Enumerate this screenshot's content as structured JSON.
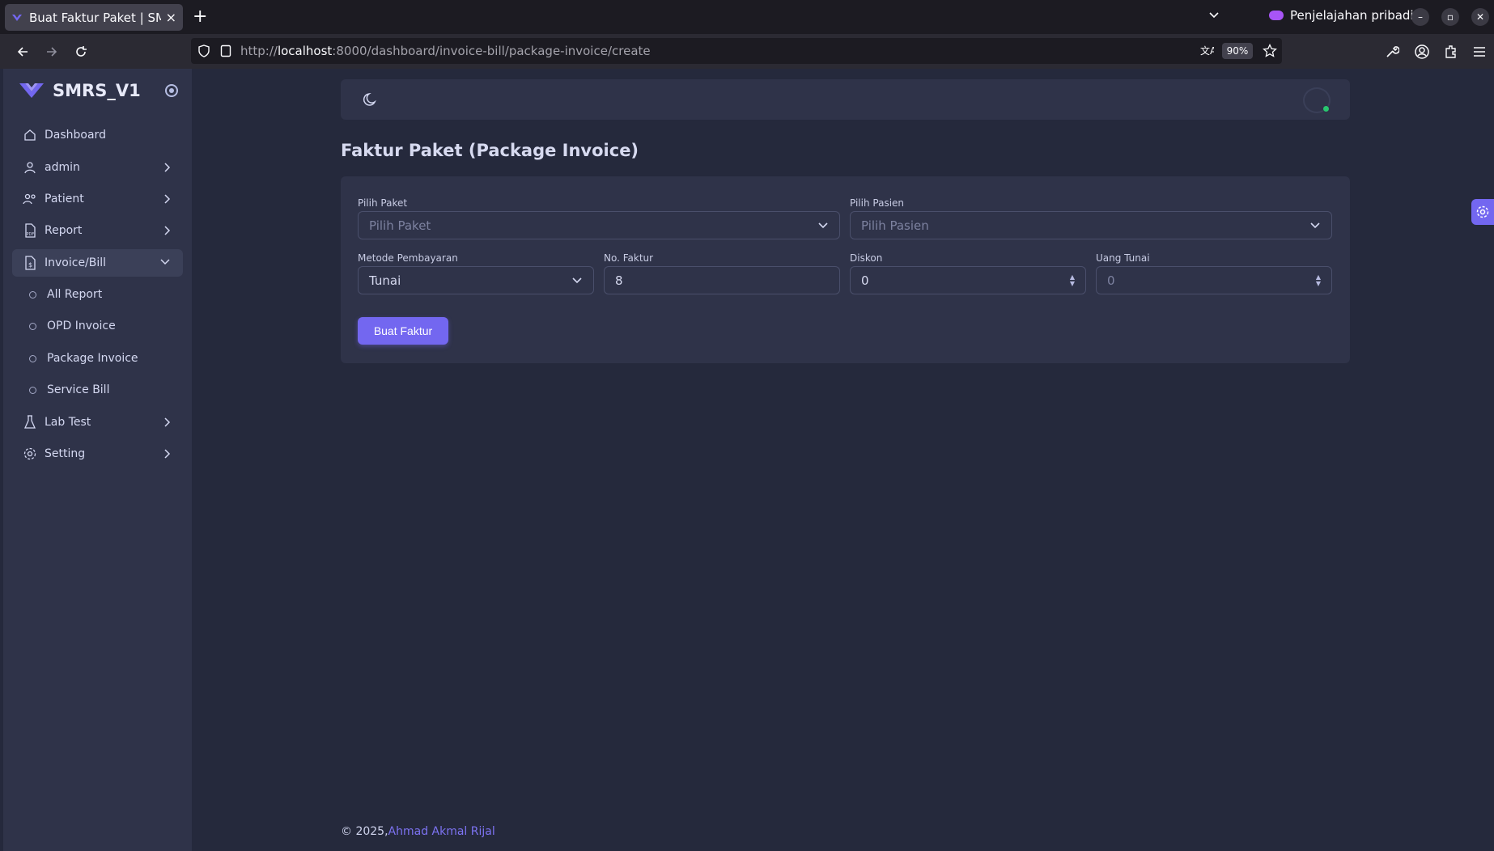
{
  "browser": {
    "tab_title": "Buat Faktur Paket | SMRS",
    "tab_close": "×",
    "new_tab": "+",
    "private_label": "Penjelajahan pribadi",
    "url_prefix": "http://",
    "url_host": "localhost",
    "url_rest": ":8000/dashboard/invoice-bill/package-invoice/create",
    "zoom": "90%"
  },
  "sidebar": {
    "brand": "SMRS_V1",
    "items": [
      {
        "label": "Dashboard",
        "icon": "home-icon"
      },
      {
        "label": "admin",
        "icon": "user-icon"
      },
      {
        "label": "Patient",
        "icon": "users-icon"
      },
      {
        "label": "Report",
        "icon": "pdf-icon"
      },
      {
        "label": "Invoice/Bill",
        "icon": "invoice-icon"
      },
      {
        "label": "Lab Test",
        "icon": "flask-icon"
      },
      {
        "label": "Setting",
        "icon": "gear-icon"
      }
    ],
    "sub_items": [
      "All Report",
      "OPD Invoice",
      "Package Invoice",
      "Service Bill"
    ]
  },
  "page": {
    "title": "Faktur Paket (Package Invoice)"
  },
  "form": {
    "package_label": "Pilih Paket",
    "package_placeholder": "Pilih Paket",
    "patient_label": "Pilih Pasien",
    "patient_placeholder": "Pilih Pasien",
    "payment_label": "Metode Pembayaran",
    "payment_value": "Tunai",
    "invoice_no_label": "No. Faktur",
    "invoice_no_value": "8",
    "discount_label": "Diskon",
    "discount_value": "0",
    "cash_label": "Uang Tunai",
    "cash_placeholder": "0",
    "submit_label": "Buat Faktur"
  },
  "footer": {
    "copyright": "© 2025,",
    "author": "Ahmad Akmal Rijal"
  },
  "colors": {
    "primary": "#7367f0",
    "background": "#25293c",
    "card": "#2f3349",
    "status_online": "#28c76f"
  }
}
